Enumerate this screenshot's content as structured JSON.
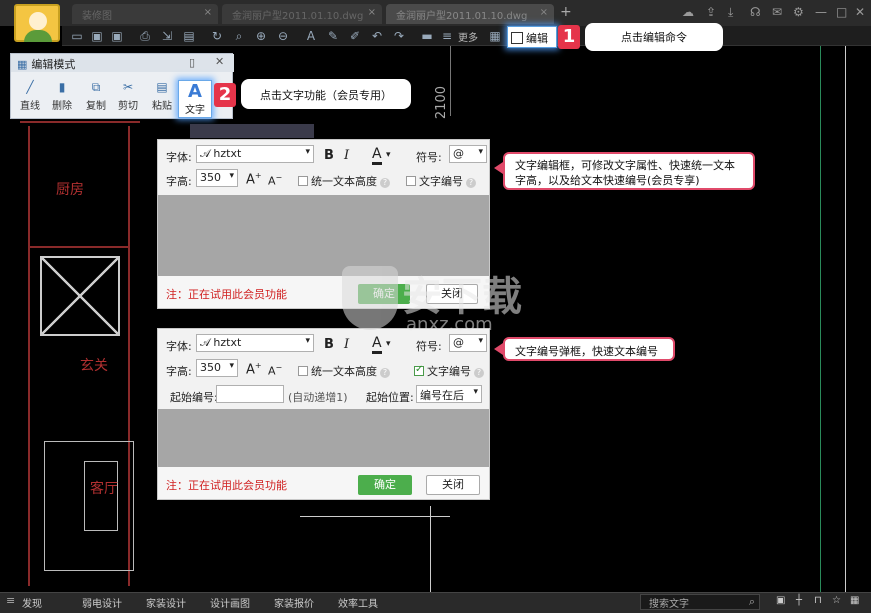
{
  "tabs": [
    {
      "label": "装修图"
    },
    {
      "label": "金润丽户型2011.01.10.dwg"
    },
    {
      "label": "金润丽户型2011.01.10.dwg"
    }
  ],
  "toolbar": {
    "more_label": "更多",
    "edit_label": "编辑"
  },
  "callouts": {
    "c1_badge": "1",
    "c1_text": "点击编辑命令",
    "c2_badge": "2",
    "c2_text": "点击文字功能（会员专用）",
    "c3_text": "文字编辑框，可修改文字属性、快速统一文本字高，以及给文本快速编号(会员专享)",
    "c4_text": "文字编号弹框，快速文本编号"
  },
  "edit_panel": {
    "title": "编辑模式",
    "tools": [
      {
        "label": "直线",
        "icon": "line-icon"
      },
      {
        "label": "删除",
        "icon": "trash-icon"
      },
      {
        "label": "复制",
        "icon": "copy-icon"
      },
      {
        "label": "剪切",
        "icon": "scissors-icon"
      },
      {
        "label": "粘贴",
        "icon": "paste-icon"
      }
    ],
    "text_tool_label": "文字"
  },
  "cad": {
    "dimension": "2100",
    "rooms": [
      "厨房",
      "玄关",
      "客厅"
    ]
  },
  "dialog1": {
    "font_label": "字体:",
    "font_value": "hztxt",
    "bold": "B",
    "italic": "I",
    "symbol_label": "符号:",
    "symbol_value": "@",
    "height_label": "字高:",
    "height_value": "350",
    "uniform_height": "统一文本高度",
    "text_number": "文字编号",
    "warning": "注：正在试用此会员功能",
    "ok": "确定",
    "close": "关闭"
  },
  "dialog2": {
    "font_label": "字体:",
    "font_value": "hztxt",
    "bold": "B",
    "italic": "I",
    "symbol_label": "符号:",
    "symbol_value": "@",
    "height_label": "字高:",
    "height_value": "350",
    "uniform_height": "统一文本高度",
    "text_number": "文字编号",
    "start_num_label": "起始编号:",
    "start_num_value": "",
    "auto_inc": "(自动递增1)",
    "start_pos_label": "起始位置:",
    "start_pos_value": "编号在后",
    "warning": "注：正在试用此会员功能",
    "ok": "确定",
    "close": "关闭"
  },
  "statusbar": {
    "items": [
      "发现",
      "弱电设计",
      "家装设计",
      "设计画图",
      "家装报价",
      "效率工具"
    ],
    "search": "搜索文字"
  },
  "watermark": {
    "text": "安下载",
    "sub": "anxz.com"
  }
}
